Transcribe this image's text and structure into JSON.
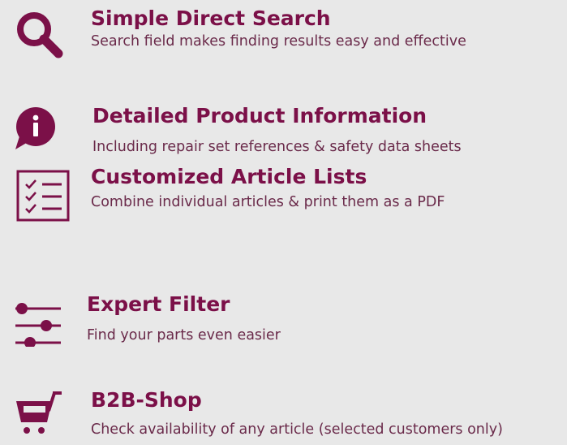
{
  "colors": {
    "background": "#e8e8e8",
    "accent": "#7b1048",
    "text": "#6a2a4a"
  },
  "features": [
    {
      "icon": "search-icon",
      "title": "Simple Direct Search",
      "description": "Search field makes finding results easy and effective"
    },
    {
      "icon": "info-speech-bubble-icon",
      "title": "Detailed Product Information",
      "description": "Including repair set references & safety data sheets"
    },
    {
      "icon": "checklist-icon",
      "title": "Customized Article Lists",
      "description": "Combine individual articles & print them as a PDF"
    },
    {
      "icon": "sliders-filter-icon",
      "title": "Expert Filter",
      "description": "Find your parts even easier"
    },
    {
      "icon": "shopping-cart-icon",
      "title": "B2B-Shop",
      "description": "Check availability of any article (selected customers only)"
    }
  ]
}
